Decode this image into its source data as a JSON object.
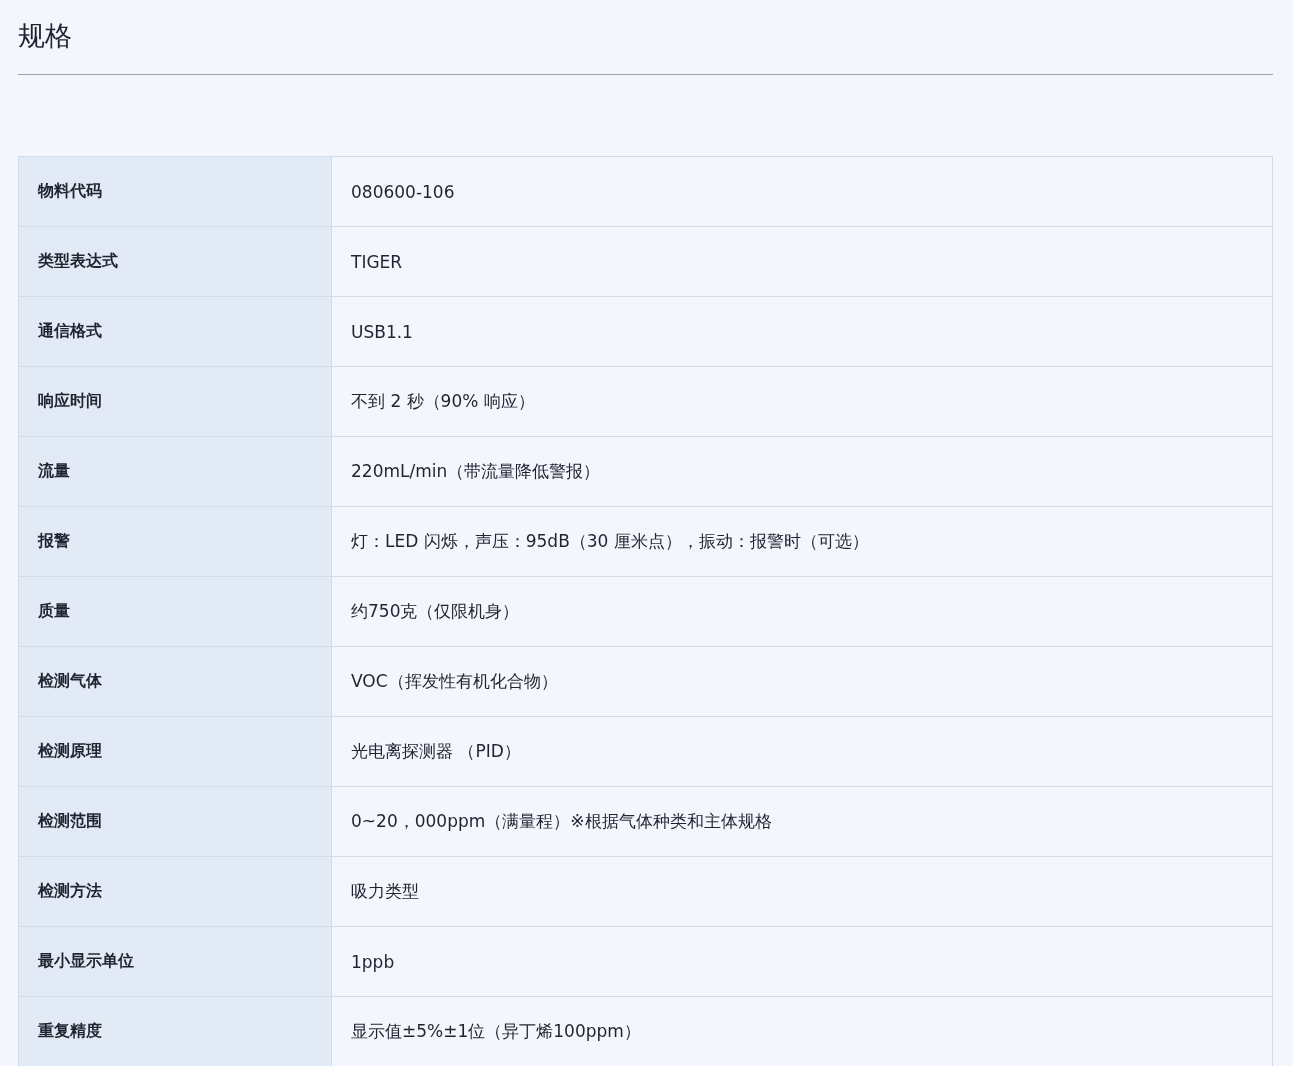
{
  "title": "规格",
  "specs": [
    {
      "label": "物料代码",
      "value": "080600-106"
    },
    {
      "label": "类型表达式",
      "value": "TIGER"
    },
    {
      "label": "通信格式",
      "value": "USB1.1"
    },
    {
      "label": "响应时间",
      "value": "不到 2 秒（90% 响应）"
    },
    {
      "label": "流量",
      "value": "220mL/min（带流量降低警报）"
    },
    {
      "label": "报警",
      "value": "灯：LED 闪烁，声压：95dB（30 厘米点），振动：报警时（可选）"
    },
    {
      "label": "质量",
      "value": "约750克（仅限机身）"
    },
    {
      "label": "检测气体",
      "value": "VOC（挥发性有机化合物）"
    },
    {
      "label": "检测原理",
      "value": "光电离探测器 （PID）"
    },
    {
      "label": "检测范围",
      "value": "0~20，000ppm（满量程）※根据气体种类和主体规格"
    },
    {
      "label": "检测方法",
      "value": "吸力类型"
    },
    {
      "label": "最小显示单位",
      "value": "1ppb"
    },
    {
      "label": "重复精度",
      "value": "显示值±5%±1位（异丁烯100ppm）"
    }
  ]
}
